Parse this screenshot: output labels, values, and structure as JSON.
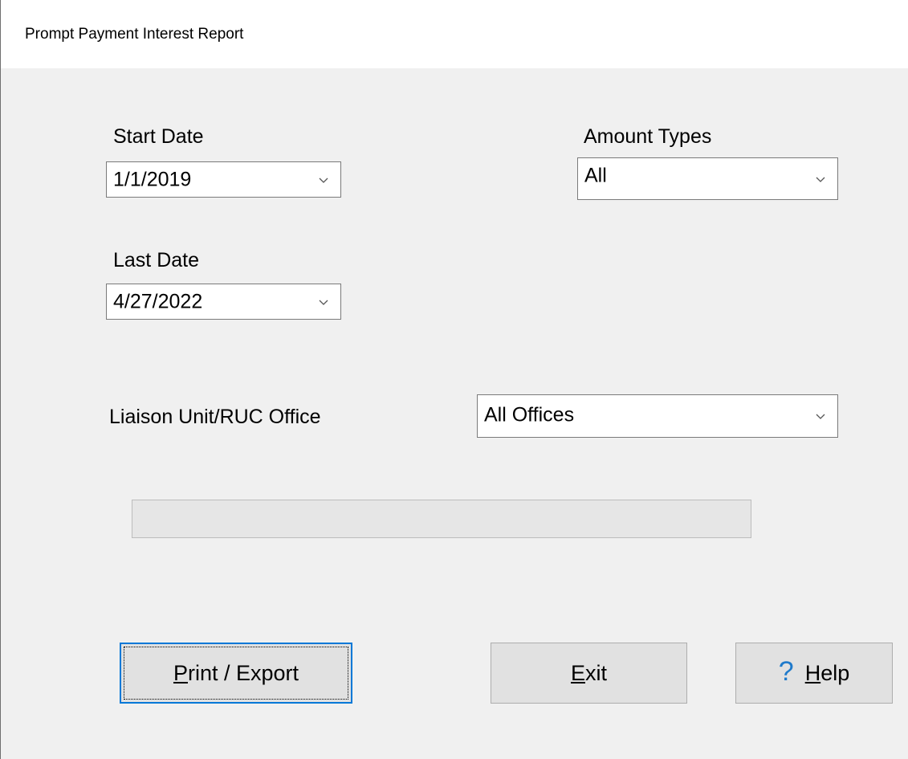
{
  "window": {
    "title": "Prompt Payment Interest Report"
  },
  "form": {
    "start_date": {
      "label": "Start Date",
      "value": "1/1/2019"
    },
    "last_date": {
      "label": "Last Date",
      "value": "4/27/2022"
    },
    "amount_types": {
      "label": "Amount Types",
      "value": "All"
    },
    "office": {
      "label": "Liaison Unit/RUC Office",
      "value": "All Offices"
    },
    "progress": {
      "percent": 0
    }
  },
  "buttons": {
    "print_export": {
      "mnemonic": "P",
      "rest": "rint / Export"
    },
    "exit": {
      "mnemonic": "E",
      "rest": "xit"
    },
    "help": {
      "icon": "question-mark-icon",
      "glyph": "?",
      "mnemonic": "H",
      "rest": "elp"
    }
  },
  "colors": {
    "window_bg": "#f0f0f0",
    "button_bg": "#e1e1e1",
    "focus_border": "#0078d7",
    "help_icon": "#1f7acb"
  }
}
